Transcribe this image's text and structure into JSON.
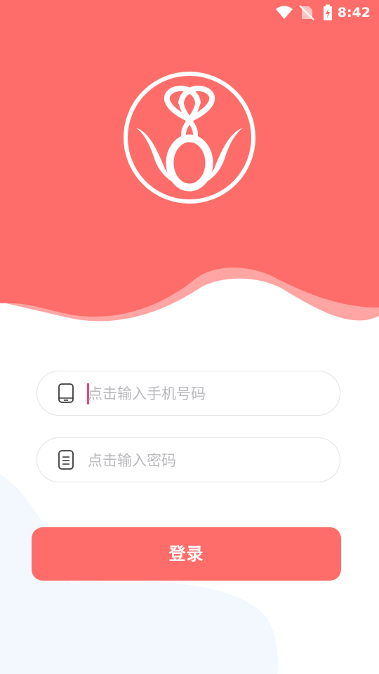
{
  "status_bar": {
    "time": "8:42",
    "icons": [
      "wifi-icon",
      "no-sim-icon",
      "battery-charging-icon"
    ]
  },
  "colors": {
    "brand": "#fe6d69",
    "brand_light": "#ffa5a3",
    "placeholder": "#b9b9bf",
    "caret": "#e8457a",
    "bottom_blob": "#f2f8fd"
  },
  "logo": {
    "icon": "app-logo-icon"
  },
  "form": {
    "phone": {
      "icon": "tablet-icon",
      "placeholder": "点击输入手机号码",
      "value": ""
    },
    "password": {
      "icon": "document-icon",
      "placeholder": "点击输入密码",
      "value": ""
    },
    "login_label": "登录"
  }
}
